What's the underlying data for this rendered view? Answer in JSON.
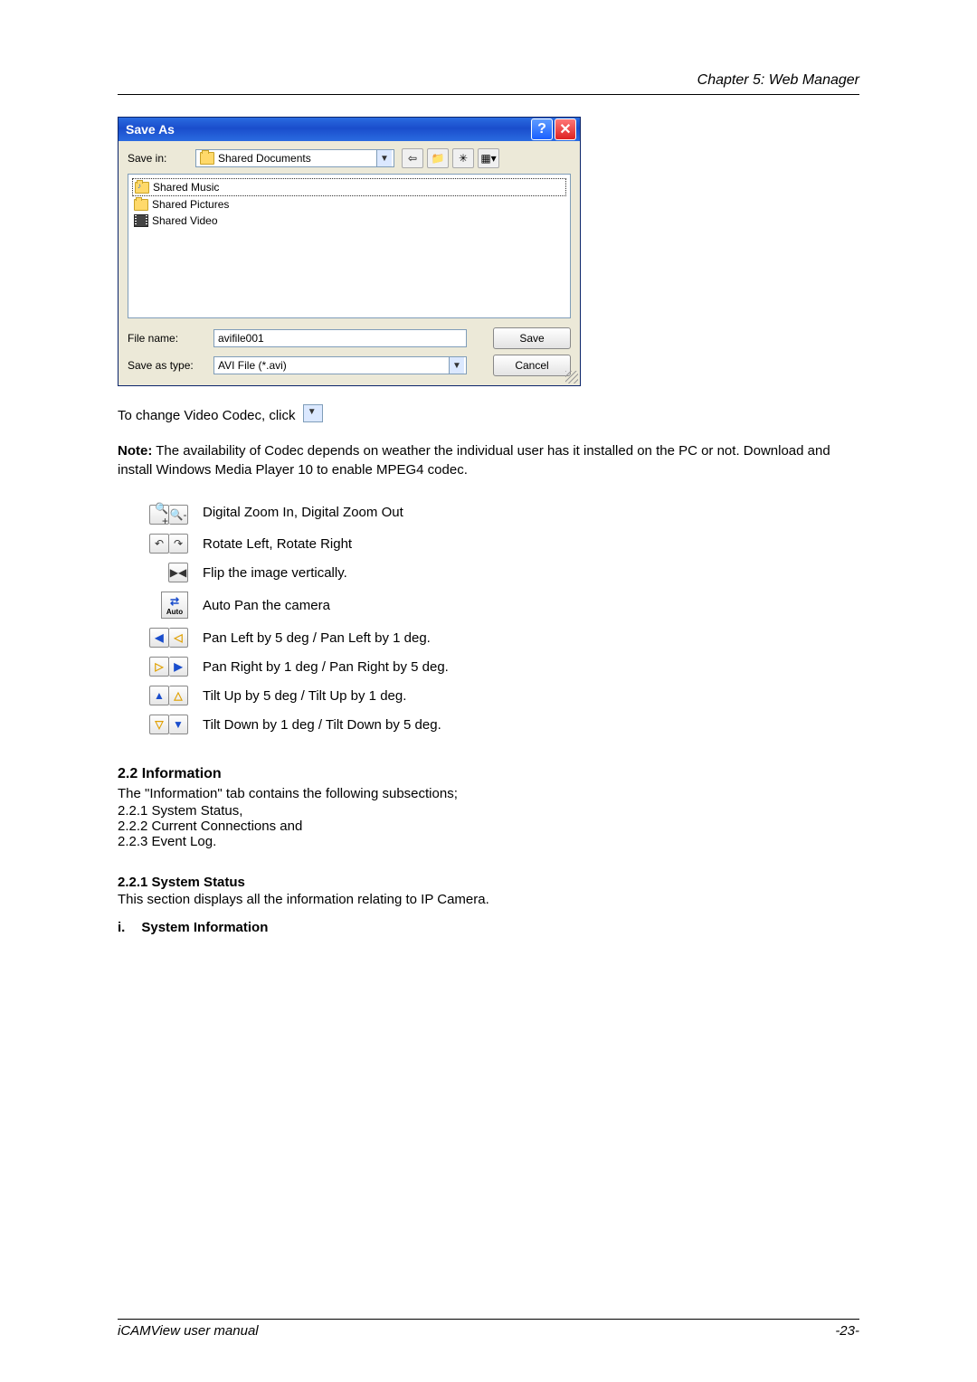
{
  "header": {
    "chapter": "Chapter 5: Web Manager"
  },
  "dialog": {
    "title": "Save As",
    "savein_label": "Save in:",
    "savein_value": "Shared Documents",
    "items": [
      {
        "name": "Shared Music"
      },
      {
        "name": "Shared Pictures"
      },
      {
        "name": "Shared Video"
      }
    ],
    "filename_label": "File name:",
    "filename_value": "avifile001",
    "type_label": "Save as type:",
    "type_value": "AVI File (*.avi)",
    "save_btn": "Save",
    "cancel_btn": "Cancel"
  },
  "text": {
    "codec_line": "To change Video Codec, click",
    "note_label": "Note:",
    "note_body": " The availability of Codec depends on weather the individual user has it installed on the PC or not. Download and install Windows Media Player 10 to enable MPEG4 codec."
  },
  "controls": {
    "zoom": "Digital Zoom In, Digital Zoom Out",
    "rotate": "Rotate Left, Rotate Right",
    "flip": "Flip the image vertically.",
    "autopan_label": "Auto",
    "autopan": "Auto Pan the camera",
    "panleft": "Pan Left by 5 deg / Pan Left by 1 deg.",
    "panright": "Pan Right by 1 deg / Pan Right by 5 deg.",
    "tiltup": "Tilt Up by 5 deg / Tilt Up by 1 deg.",
    "tiltdown": "Tilt Down by 1 deg / Tilt Down by 5 deg."
  },
  "sections": {
    "info_title": "2.2 Information",
    "info_intro": "The \"Information\" tab contains the following subsections;",
    "info_items": [
      "2.2.1 System Status,",
      "2.2.2 Current Connections and",
      "2.2.3 Event Log."
    ],
    "status_title": "2.2.1 System Status",
    "status_body": "This section displays all the information relating to IP Camera.",
    "roman_i": "i.",
    "roman_i_title": "System Information"
  },
  "footer": {
    "left": "iCAMView  user  manual",
    "right": "-23-"
  }
}
